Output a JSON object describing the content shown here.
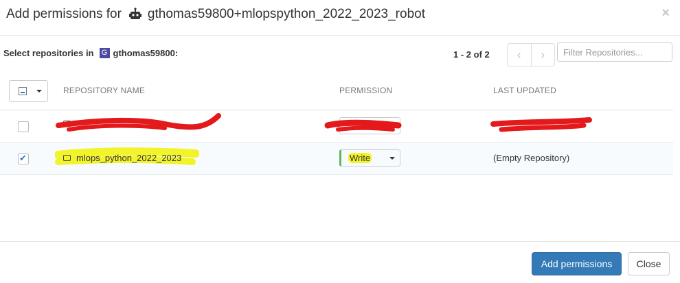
{
  "modal": {
    "title_prefix": "Add permissions for",
    "robot_name": "gthomas59800+mlopspython_2022_2023_robot",
    "close_glyph": "×"
  },
  "toolbar": {
    "select_label": "Select repositories in",
    "org_initial": "G",
    "org_name": "gthomas59800:",
    "pager_text": "1 - 2 of 2",
    "prev_glyph": "‹",
    "next_glyph": "›",
    "filter_placeholder": "Filter Repositories..."
  },
  "table": {
    "headers": {
      "repository": "REPOSITORY NAME",
      "permission": "PERMISSION",
      "last_updated": "LAST UPDATED"
    },
    "rows": [
      {
        "name": "",
        "permission": "",
        "last_updated": "",
        "checked": false,
        "redacted": true
      },
      {
        "name": "mlops_python_2022_2023",
        "permission": "Write",
        "last_updated": "(Empty Repository)",
        "checked": true,
        "redacted": false
      }
    ]
  },
  "footer": {
    "add_label": "Add permissions",
    "close_label": "Close"
  },
  "colors": {
    "primary": "#337ab7",
    "highlight": "#f3f32a",
    "redaction": "#e3191b",
    "permission_accent": "#5cb85c"
  },
  "icons": [
    "robot-icon",
    "org-avatar-icon",
    "repository-icon",
    "checkmark-icon",
    "caret-down-icon",
    "chevron-left-icon",
    "chevron-right-icon",
    "close-icon"
  ]
}
